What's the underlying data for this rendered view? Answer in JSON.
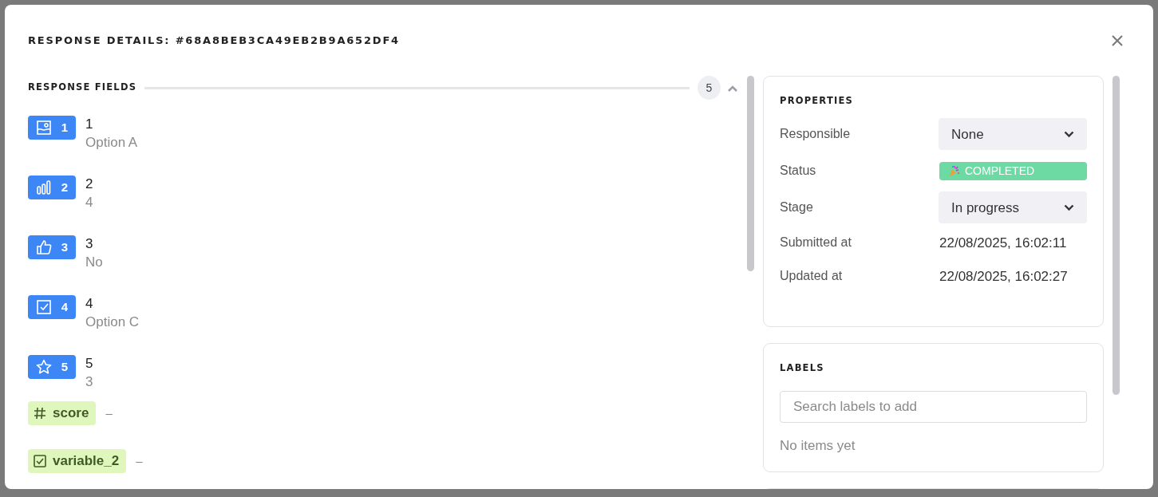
{
  "modal": {
    "title": "RESPONSE DETAILS: #68A8BEB3CA49EB2B9A652DF4"
  },
  "response_fields": {
    "title": "RESPONSE FIELDS",
    "count": "5",
    "expanded": true,
    "fields": [
      {
        "kind": "picture",
        "number": "1",
        "title": "1",
        "value": "Option A"
      },
      {
        "kind": "rating",
        "number": "2",
        "title": "2",
        "value": "4"
      },
      {
        "kind": "yesno",
        "number": "3",
        "title": "3",
        "value": "No"
      },
      {
        "kind": "checkbox",
        "number": "4",
        "title": "4",
        "value": "Option C"
      },
      {
        "kind": "star",
        "number": "5",
        "title": "5",
        "value": "3"
      }
    ],
    "variables": [
      {
        "kind": "number",
        "name": "score",
        "value": "–"
      },
      {
        "kind": "boolean",
        "name": "variable_2",
        "value": "–"
      }
    ]
  },
  "properties": {
    "title": "PROPERTIES",
    "rows": [
      {
        "kind": "select",
        "label": "Responsible",
        "value": "None"
      },
      {
        "kind": "status",
        "label": "Status",
        "value": "COMPLETED"
      },
      {
        "kind": "select",
        "label": "Stage",
        "value": "In progress"
      },
      {
        "kind": "text",
        "label": "Submitted at",
        "value": "22/08/2025, 16:02:11"
      },
      {
        "kind": "text",
        "label": "Updated at",
        "value": "22/08/2025, 16:02:27"
      }
    ]
  },
  "labels": {
    "title": "LABELS",
    "search": {
      "placeholder": "Search labels to add"
    },
    "empty": "No items yet"
  }
}
